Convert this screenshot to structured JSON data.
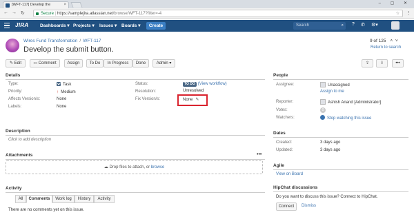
{
  "browser": {
    "tab_title": "[WFT-117] Develop the",
    "tab_close": "×",
    "secure_label": "Secure",
    "url_host": "https://samplejira.atlassian.net",
    "url_path": "/browse/WFT-117?filter=-4",
    "window_controls": "– ▢ ✕"
  },
  "header": {
    "logo": "JIRA",
    "nav": [
      "Dashboards ▾",
      "Projects ▾",
      "Issues ▾",
      "Boards ▾"
    ],
    "create_label": "Create",
    "search_placeholder": "Search"
  },
  "issue": {
    "project": "Wires Fund Transformation",
    "breadcrumb_sep": "/",
    "key": "WFT-117",
    "summary": "Develop the submit button.",
    "pager": "9 of 125",
    "return_to_search": "Return to search"
  },
  "toolbar": {
    "edit": "Edit",
    "comment": "Comment",
    "assign": "Assign",
    "todo": "To Do",
    "in_progress": "In Progress",
    "done": "Done",
    "admin": "Admin ▾"
  },
  "details": {
    "heading": "Details",
    "type_label": "Type:",
    "type_value": "Task",
    "priority_label": "Priority:",
    "priority_value": "Medium",
    "affects_label": "Affects Version/s:",
    "affects_value": "None",
    "labels_label": "Labels:",
    "labels_value": "None",
    "status_label": "Status:",
    "status_value": "TO DO",
    "view_workflow": "(View workflow)",
    "resolution_label": "Resolution:",
    "resolution_value": "Unresolved",
    "fix_label": "Fix Version/s:",
    "fix_value": "None"
  },
  "description": {
    "heading": "Description",
    "placeholder": "Click to add description"
  },
  "attachments": {
    "heading": "Attachments",
    "drop_text": "Drop files to attach, or",
    "browse": "browse"
  },
  "activity": {
    "heading": "Activity",
    "tabs": [
      "All",
      "Comments",
      "Work log",
      "History",
      "Activity"
    ],
    "empty": "There are no comments yet on this issue."
  },
  "people": {
    "heading": "People",
    "assignee_label": "Assignee:",
    "assignee_value": "Unassigned",
    "assign_to_me": "Assign to me",
    "reporter_label": "Reporter:",
    "reporter_value": "Ashish Anand [Administrator]",
    "votes_label": "Votes:",
    "votes_value": "0",
    "watchers_label": "Watchers:",
    "watchers_value": "Stop watching this issue",
    "watchers_count": "1"
  },
  "dates": {
    "heading": "Dates",
    "created_label": "Created:",
    "created_value": "3 days ago",
    "updated_label": "Updated:",
    "updated_value": "3 days ago"
  },
  "agile": {
    "heading": "Agile",
    "view_on_board": "View on Board"
  },
  "hipchat": {
    "heading": "HipChat discussions",
    "prompt": "Do you want to discuss this issue? Connect to HipChat.",
    "connect": "Connect",
    "dismiss": "Dismiss"
  },
  "colors": {
    "header_bg": "#205081",
    "link": "#3b73af",
    "highlight_box": "#d9232e"
  }
}
